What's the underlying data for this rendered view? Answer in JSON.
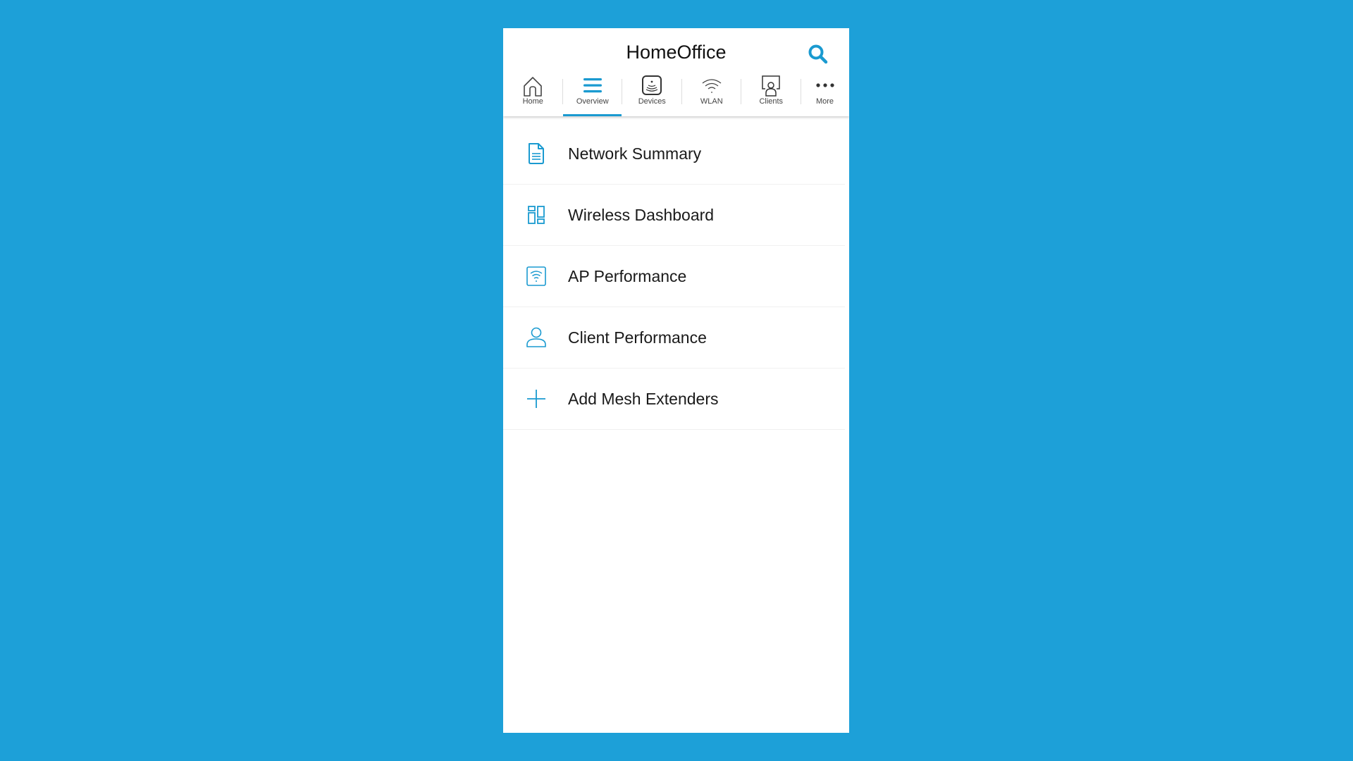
{
  "header": {
    "title": "HomeOffice",
    "search_icon": "search-icon"
  },
  "tabs": [
    {
      "label": "Home",
      "icon": "home-icon",
      "active": false
    },
    {
      "label": "Overview",
      "icon": "menu-icon",
      "active": true
    },
    {
      "label": "Devices",
      "icon": "device-icon",
      "active": false
    },
    {
      "label": "WLAN",
      "icon": "wifi-icon",
      "active": false
    },
    {
      "label": "Clients",
      "icon": "client-icon",
      "active": false
    },
    {
      "label": "More",
      "icon": "more-icon",
      "active": false
    }
  ],
  "menu": [
    {
      "label": "Network Summary",
      "icon": "document-icon"
    },
    {
      "label": "Wireless Dashboard",
      "icon": "dashboard-icon"
    },
    {
      "label": "AP Performance",
      "icon": "access-point-icon"
    },
    {
      "label": "Client Performance",
      "icon": "user-icon"
    },
    {
      "label": "Add Mesh Extenders",
      "icon": "plus-icon"
    }
  ],
  "colors": {
    "background": "#1DA0D8",
    "accent": "#1A9AD0",
    "panel": "#FFFFFF",
    "text": "#1A1A1A"
  }
}
